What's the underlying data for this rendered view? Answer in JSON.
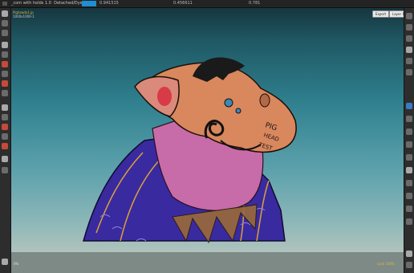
{
  "window": {
    "title": "_com with holds 1.0",
    "subtitle": "Detached/Dyer",
    "values": [
      "0.941515",
      "0.456611",
      "0.781"
    ]
  },
  "document": {
    "name": "Pigheadx1.jp",
    "size": "1000x1000-1"
  },
  "buttons": {
    "left": "Export",
    "right": "Layer 1"
  },
  "status": {
    "left": "0%",
    "zoom": "Lock 100%"
  },
  "artwork_text": [
    "PIG",
    "HEAD",
    "TEST"
  ],
  "colors": {
    "accent": "#1e8fd2",
    "sweater_blue": "#3a2aa0",
    "skin_pink": "#c76ca8",
    "head_orange": "#d9875d",
    "hair": "#1a1a1a"
  }
}
